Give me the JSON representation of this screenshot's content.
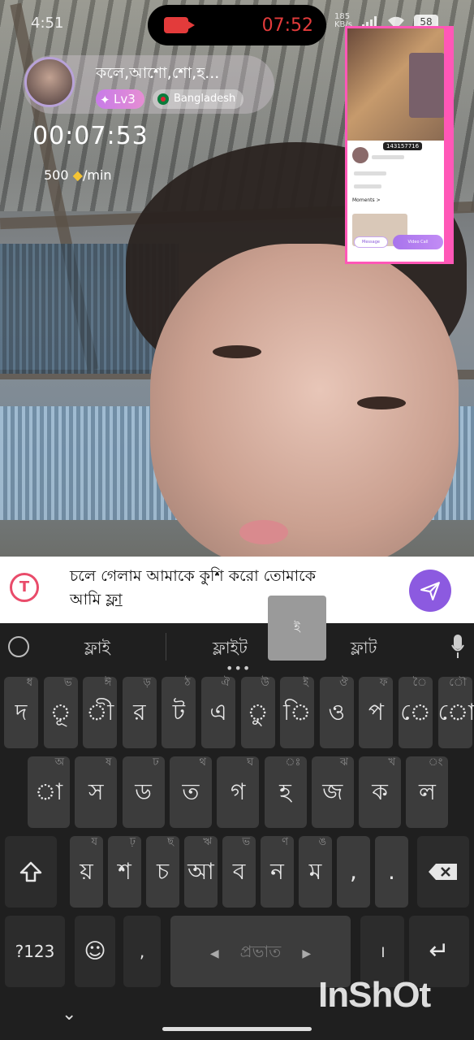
{
  "status_bar": {
    "time": "4:51",
    "call_clock": "07:52",
    "net_speed": "185 KB/s",
    "battery": "58"
  },
  "caller": {
    "name": "কলে,আশো,শো,হ...",
    "level": "Lv3",
    "country": "Bangladesh",
    "call_timer": "00:07:53",
    "rate": "500",
    "rate_unit": "/min"
  },
  "pip": {
    "user_id": "143157716",
    "section": "Moments >",
    "message_btn": "Message",
    "video_call_btn": "Video Call"
  },
  "input": {
    "line1": "চলে গেলাম আমাকে কুশি করো তোমাকে",
    "line2_prefix": "আমি ",
    "line2_underlined": "ফ্লা"
  },
  "key_popup": "ই",
  "suggestions": [
    "ফ্লাই",
    "ফ্লাইট",
    "ফ্লাট"
  ],
  "keyboard": {
    "row1": [
      {
        "k": "দ",
        "h": "ধ"
      },
      {
        "k": "ূ",
        "h": "ভ"
      },
      {
        "k": "ী",
        "h": "ঈ"
      },
      {
        "k": "র",
        "h": "ড়"
      },
      {
        "k": "ট",
        "h": "ঠ"
      },
      {
        "k": "এ",
        "h": "ঐ"
      },
      {
        "k": "ু",
        "h": "উ"
      },
      {
        "k": "ি",
        "h": "ই"
      },
      {
        "k": "ও",
        "h": "ঔ"
      },
      {
        "k": "প",
        "h": "ফ"
      },
      {
        "k": "ে",
        "h": "ৈ"
      },
      {
        "k": "ো",
        "h": "ৌ"
      }
    ],
    "row2": [
      {
        "k": "া",
        "h": "অ"
      },
      {
        "k": "স",
        "h": "ষ"
      },
      {
        "k": "ড",
        "h": "ঢ"
      },
      {
        "k": "ত",
        "h": "থ"
      },
      {
        "k": "গ",
        "h": "ঘ"
      },
      {
        "k": "হ",
        "h": "ঃ"
      },
      {
        "k": "জ",
        "h": "ঝ"
      },
      {
        "k": "ক",
        "h": "খ"
      },
      {
        "k": "ল",
        "h": "ং"
      }
    ],
    "row3": [
      {
        "k": "য়",
        "h": "য"
      },
      {
        "k": "শ",
        "h": "ঢ়"
      },
      {
        "k": "চ",
        "h": "ছ"
      },
      {
        "k": "আ",
        "h": "ঋ"
      },
      {
        "k": "ব",
        "h": "ভ"
      },
      {
        "k": "ন",
        "h": "ণ"
      },
      {
        "k": "ম",
        "h": "ঙ"
      },
      {
        "k": ",",
        "h": ""
      },
      {
        "k": ".",
        "h": ""
      }
    ],
    "num_key": "?123",
    "comma": ",",
    "space": "প্রভাত",
    "danda": "।"
  },
  "watermark": "InShOt",
  "colors": {
    "accent": "#8c5ae0",
    "pip_border": "#ff57b7",
    "call_red": "#e23b3b"
  }
}
